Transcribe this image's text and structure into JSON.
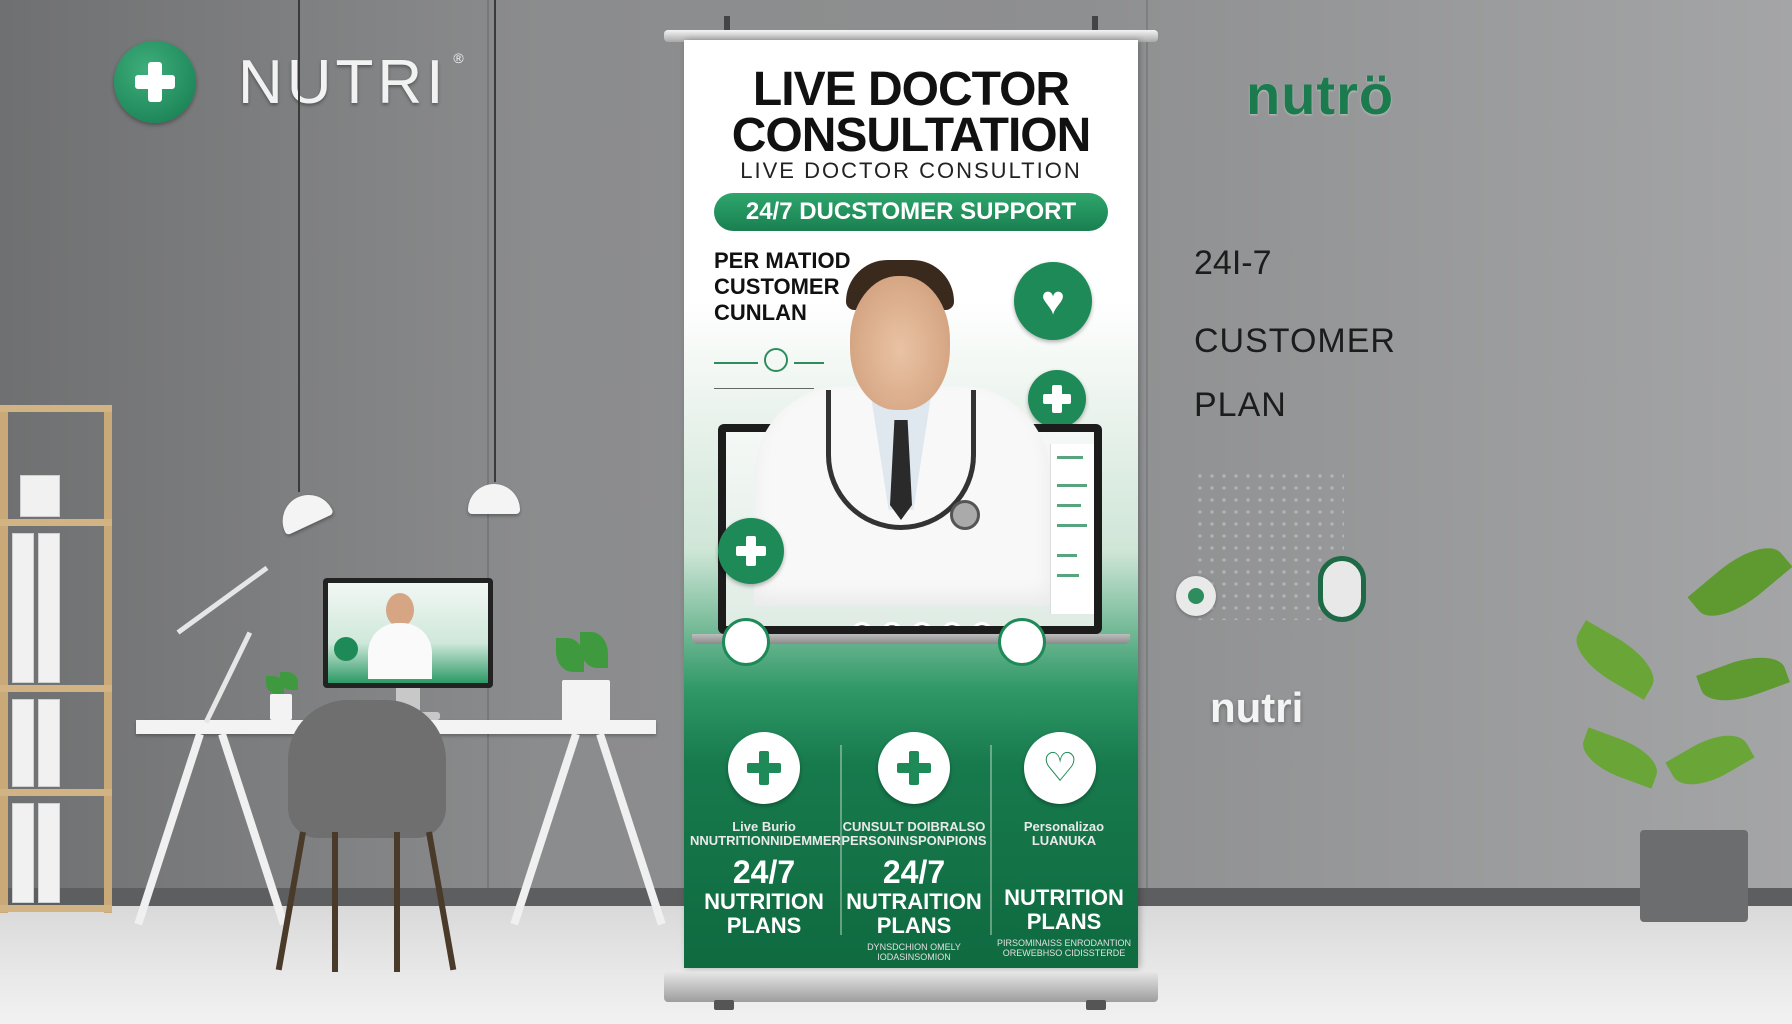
{
  "wall": {
    "logo_left": {
      "icon": "plus-circle-icon",
      "text": "NUTRI",
      "mark": "®"
    },
    "logo_right": {
      "text": "nutrö"
    },
    "text_1": "24I-7",
    "text_2": "CUSTOMER",
    "text_3": "PLAN",
    "nutri_small": "nutri"
  },
  "banner": {
    "title_line_1": "LIVE DOCTOR",
    "title_line_2": "CONSULTATION",
    "subtitle": "LIVE DOCTOR CONSULTION",
    "pill": "24/7 DUCSTOMER SUPPORT",
    "side_text": [
      "PER MATIOD",
      "CUSTOMER",
      "CUNLAN"
    ],
    "columns": [
      {
        "icon": "plus-icon",
        "small_label": "Live Burio\nNNUTRITIONNIDEMMER",
        "big": "24/7",
        "mid": "NUTRITION\nPLANS",
        "tiny": ""
      },
      {
        "icon": "plus-icon",
        "small_label": "CUNSULT DOIBRALSO\nPERSONINSPONPIONS",
        "big": "24/7",
        "mid": "NUTRAITION\nPLANS",
        "tiny": "DYNSDCHION OMELY IODASINSOMION"
      },
      {
        "icon": "heart-icon",
        "small_label": "Personalizao\nLUANUKA",
        "big": "",
        "mid": "NUTRITION\nPLANS",
        "tiny": "PIRSOMINAISS ENRODANTION\nOREWEBHSO CIDISSTERDE"
      }
    ]
  },
  "colors": {
    "brand_green": "#1e8a57",
    "dark_green": "#0f6a40",
    "wall_gray": "#8e8f90"
  }
}
